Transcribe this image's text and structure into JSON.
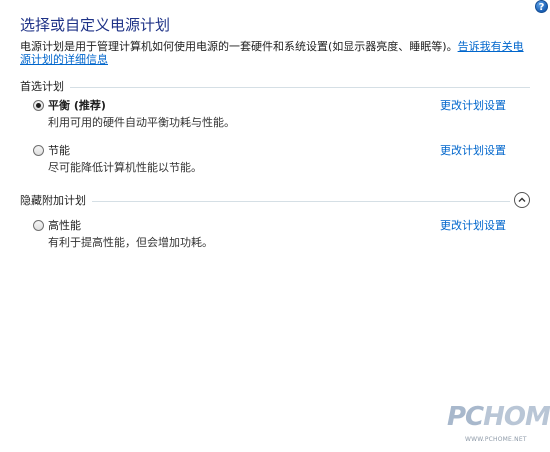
{
  "header": {
    "title": "选择或自定义电源计划",
    "help_icon": "?"
  },
  "description": {
    "text": "电源计划是用于管理计算机如何使用电源的一套硬件和系统设置(如显示器亮度、睡眠等)。",
    "link_text": "告诉我有关电源计划的详细信息"
  },
  "sections": {
    "preferred": {
      "label": "首选计划"
    },
    "hidden": {
      "label": "隐藏附加计划"
    }
  },
  "plans": {
    "balanced": {
      "name": "平衡 (推荐)",
      "desc": "利用可用的硬件自动平衡功耗与性能。",
      "link": "更改计划设置",
      "selected": true
    },
    "saver": {
      "name": "节能",
      "desc": "尽可能降低计算机性能以节能。",
      "link": "更改计划设置",
      "selected": false
    },
    "high": {
      "name": "高性能",
      "desc": "有利于提高性能，但会增加功耗。",
      "link": "更改计划设置",
      "selected": false
    }
  },
  "watermark": {
    "pc": "PC",
    "home": "HOME",
    "url": "WWW.PCHOME.NET"
  }
}
